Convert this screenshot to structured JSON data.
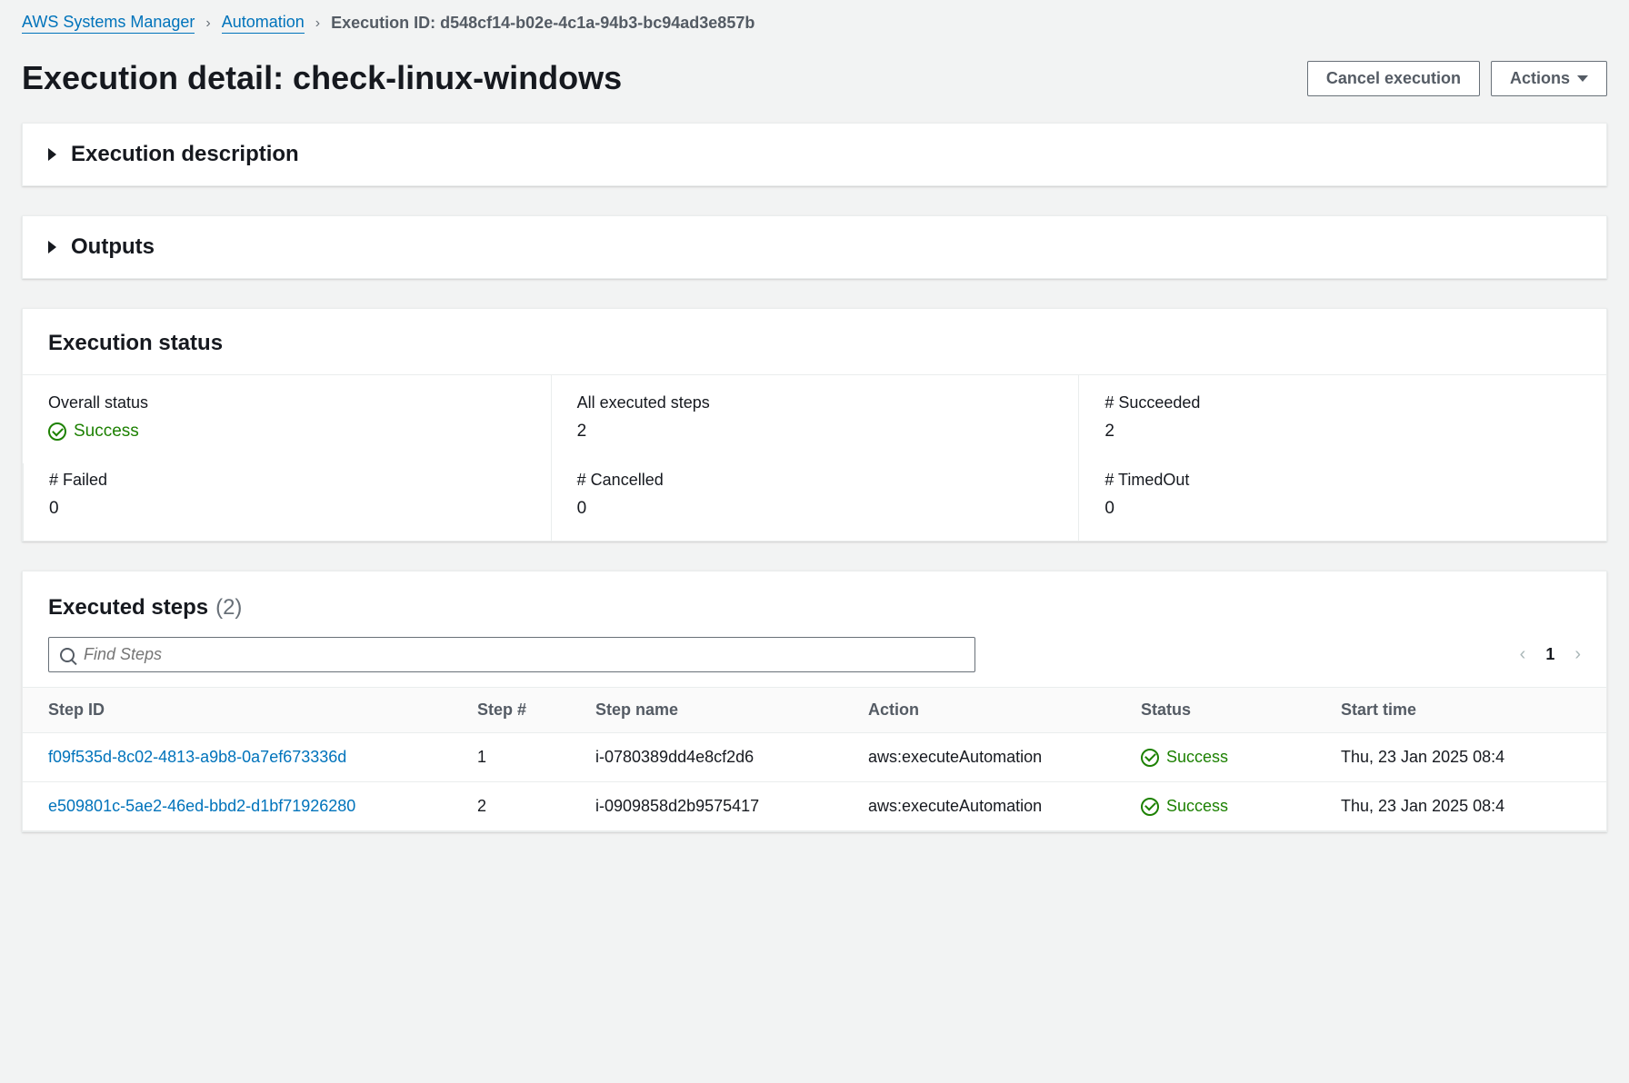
{
  "breadcrumb": {
    "root": "AWS Systems Manager",
    "section": "Automation",
    "current": "Execution ID: d548cf14-b02e-4c1a-94b3-bc94ad3e857b"
  },
  "header": {
    "title": "Execution detail: check-linux-windows",
    "cancel_label": "Cancel execution",
    "actions_label": "Actions"
  },
  "panels": {
    "desc_title": "Execution description",
    "outputs_title": "Outputs",
    "status_title": "Execution status"
  },
  "status": {
    "overall_label": "Overall status",
    "overall_value": "Success",
    "executed_label": "All executed steps",
    "executed_value": "2",
    "succeeded_label": "# Succeeded",
    "succeeded_value": "2",
    "failed_label": "# Failed",
    "failed_value": "0",
    "cancelled_label": "# Cancelled",
    "cancelled_value": "0",
    "timedout_label": "# TimedOut",
    "timedout_value": "0"
  },
  "steps": {
    "title": "Executed steps",
    "count_display": "(2)",
    "search_placeholder": "Find Steps",
    "page_current": "1",
    "columns": {
      "id": "Step ID",
      "num": "Step #",
      "name": "Step name",
      "action": "Action",
      "status": "Status",
      "start": "Start time"
    },
    "rows": [
      {
        "id": "f09f535d-8c02-4813-a9b8-0a7ef673336d",
        "num": "1",
        "name": "i-0780389dd4e8cf2d6",
        "action": "aws:executeAutomation",
        "status": "Success",
        "start": "Thu, 23 Jan 2025 08:4"
      },
      {
        "id": "e509801c-5ae2-46ed-bbd2-d1bf71926280",
        "num": "2",
        "name": "i-0909858d2b9575417",
        "action": "aws:executeAutomation",
        "status": "Success",
        "start": "Thu, 23 Jan 2025 08:4"
      }
    ]
  }
}
